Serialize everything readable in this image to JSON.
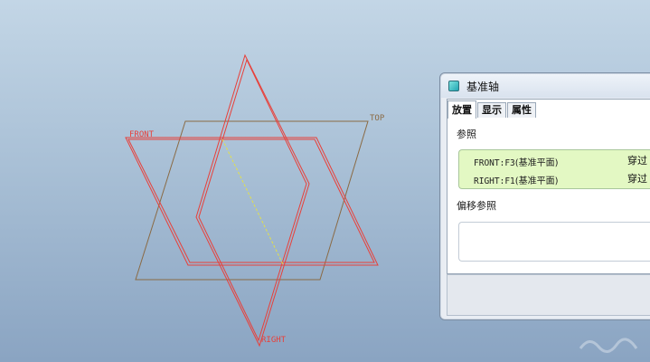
{
  "viewport": {
    "planes": [
      {
        "label": "FRONT",
        "color": "#e8403a"
      },
      {
        "label": "TOP",
        "color": "#8a6a44"
      },
      {
        "label": "RIGHT",
        "color": "#e8403a"
      }
    ],
    "axis_preview_color": "#e3e04a"
  },
  "dialog": {
    "title": "基准轴",
    "tabs": [
      {
        "label": "放置",
        "active": true
      },
      {
        "label": "显示",
        "active": false
      },
      {
        "label": "属性",
        "active": false
      }
    ],
    "references_label": "参照",
    "references": [
      {
        "code": "FRONT:F3",
        "name": "(基准平面)",
        "type": "穿过"
      },
      {
        "code": "RIGHT:F1",
        "name": "(基准平面)",
        "type": "穿过"
      }
    ],
    "offset_label": "偏移参照"
  }
}
